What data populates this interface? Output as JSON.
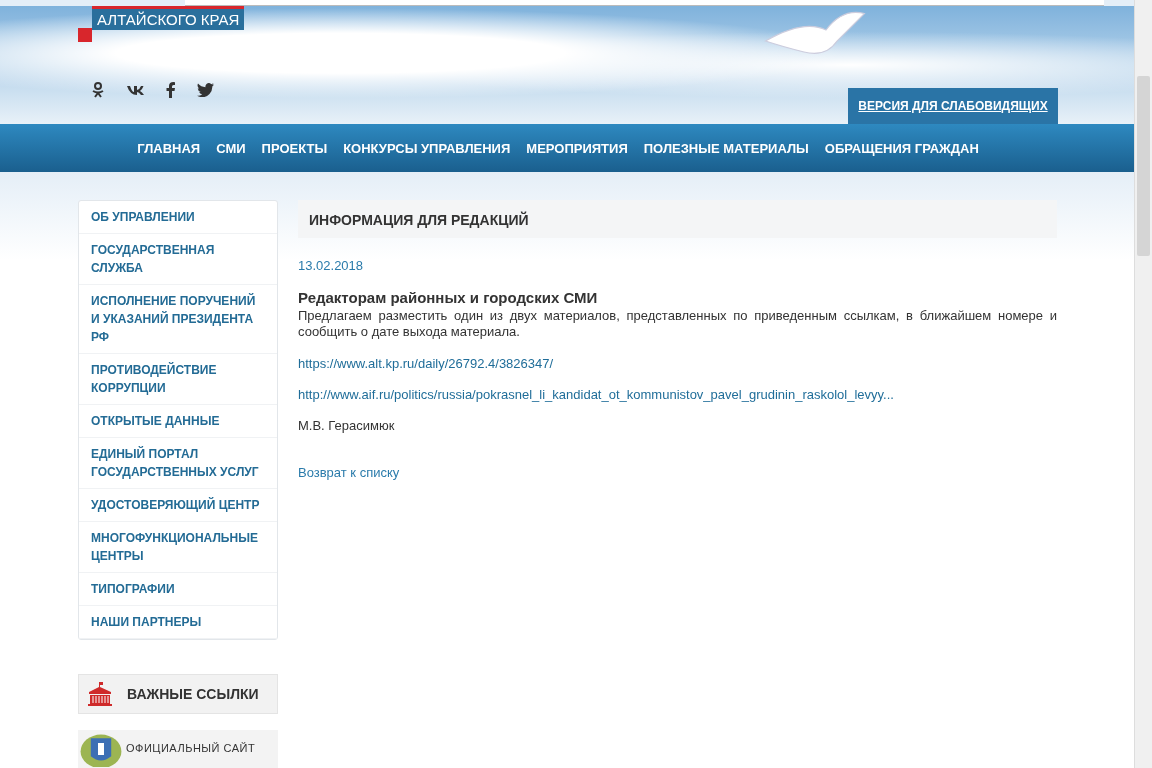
{
  "header": {
    "logo_text": "АЛТАЙСКОГО КРАЯ",
    "accessibility_link": "ВЕРСИЯ ДЛЯ СЛАБОВИДЯЩИХ"
  },
  "nav": [
    "ГЛАВНАЯ",
    "СМИ",
    "ПРОЕКТЫ",
    "КОНКУРСЫ УПРАВЛЕНИЯ",
    "МЕРОПРИЯТИЯ",
    "ПОЛЕЗНЫЕ МАТЕРИАЛЫ",
    "ОБРАЩЕНИЯ ГРАЖДАН"
  ],
  "sidebar": {
    "items": [
      {
        "label": "ОБ УПРАВЛЕНИИ"
      },
      {
        "label": "ГОСУДАРСТВЕННАЯ СЛУЖБА"
      },
      {
        "label": "ИСПОЛНЕНИЕ ПОРУЧЕНИЙ И УКАЗАНИЙ ПРЕЗИДЕНТА РФ"
      },
      {
        "label": "ПРОТИВОДЕЙСТВИЕ КОРРУПЦИИ"
      },
      {
        "label": "ОТКРЫТЫЕ ДАННЫЕ"
      },
      {
        "label": "ЕДИНЫЙ ПОРТАЛ ГОСУДАРСТВЕННЫХ УСЛУГ"
      },
      {
        "label": "УДОСТОВЕРЯЮЩИЙ ЦЕНТР"
      },
      {
        "label": "МНОГОФУНКЦИОНАЛЬНЫЕ ЦЕНТРЫ"
      },
      {
        "label": "ТИПОГРАФИИ"
      },
      {
        "label": "НАШИ ПАРТНЕРЫ"
      }
    ],
    "links_title": "ВАЖНЫЕ ССЫЛКИ",
    "link_card": "ОФИЦИАЛЬНЫЙ САЙТ"
  },
  "article": {
    "section_title": "ИНФОРМАЦИЯ ДЛЯ РЕДАКЦИЙ",
    "date": "13.02.2018",
    "title": "Редакторам районных и городских СМИ",
    "body": "Предлагаем разместить один из двух материалов, представленных по приведенным ссылкам, в ближайшем номере и сообщить о дате выхода материала.",
    "links": [
      "https://www.alt.kp.ru/daily/26792.4/3826347/",
      "http://www.aif.ru/politics/russia/pokrasnel_li_kandidat_ot_kommunistov_pavel_grudinin_raskolol_levyy..."
    ],
    "author": "М.В. Герасимюк",
    "back_link": "Возврат к списку"
  }
}
